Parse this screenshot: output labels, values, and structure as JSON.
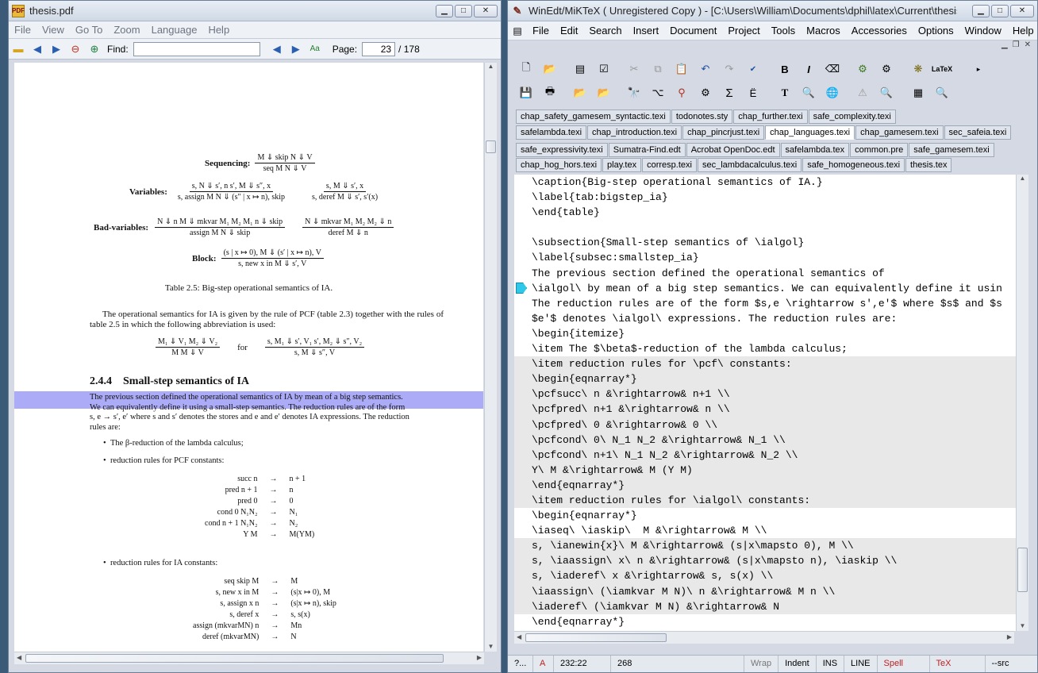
{
  "pdf": {
    "title": "thesis.pdf",
    "menu": [
      "File",
      "View",
      "Go To",
      "Zoom",
      "Language",
      "Help"
    ],
    "find_label": "Find:",
    "find_value": "",
    "page_label": "Page:",
    "page_value": "23",
    "page_total": "/ 178",
    "doc": {
      "seq_label": "Sequencing:",
      "seq_num": "M ⇓ skip   N ⇓ V",
      "seq_den": "seq  M  N ⇓ V",
      "var_label": "Variables:",
      "var1_num": "s, N ⇓ s′, n    s′, M ⇓ s″, x",
      "var1_den": "s, assign M N ⇓ (s″ | x ↦ n), skip",
      "var2_num": "s, M ⇓ s′, x",
      "var2_den": "s, deref M ⇓ s′, s′(x)",
      "bad_label": "Bad-variables:",
      "bad1_num": "N ⇓ n    M ⇓ mkvar M₁ M₂    M₁ n ⇓ skip",
      "bad1_den": "assign M N ⇓ skip",
      "bad2_num": "N ⇓ mkvar M₁ M₂    M₂ ⇓ n",
      "bad2_den": "deref M ⇓ n",
      "block_label": "Block:",
      "block_num": "(s | x ↦ 0), M ⇓ (s′ | x ↦ n), V",
      "block_den": "s, new x in M ⇓ s′, V",
      "caption": "Table 2.5: Big-step operational semantics of IA.",
      "para1": "The operational semantics for IA is given by the rule of PCF (table 2.3) together with the rules of table 2.5 in which the following abbreviation is used:",
      "abbr_l_num": "M₁ ⇓ V₁    M₂ ⇓ V₂",
      "abbr_l_den": "M M ⇓ V",
      "abbr_for": "for",
      "abbr_r_num": "s, M₁ ⇓ s′, V₁    s′, M₂ ⇓ s″, V₂",
      "abbr_r_den": "s, M ⇓ s″, V",
      "section": "2.4.4    Small-step semantics of IA",
      "para2_l1": "The previous section defined the operational semantics of IA by mean of a big step semantics.",
      "para2_l2": "We can equivalently define it using a small-step semantics.  The reduction rules are of the form",
      "para2_l3": "s, e → s′, e′ where s and s′ denotes the stores and e and e′ denotes IA expressions.  The reduction",
      "para2_l4": "rules are:",
      "bullet1": "The β-reduction of the lambda calculus;",
      "bullet2": "reduction rules for PCF constants:",
      "pcf_rules": [
        [
          "succ n",
          "→",
          "n + 1"
        ],
        [
          "pred n + 1",
          "→",
          "n"
        ],
        [
          "pred 0",
          "→",
          "0"
        ],
        [
          "cond 0 N₁N₂",
          "→",
          "N₁"
        ],
        [
          "cond n + 1 N₁N₂",
          "→",
          "N₂"
        ],
        [
          "Y M",
          "→",
          "M(YM)"
        ]
      ],
      "bullet3": "reduction rules for IA constants:",
      "ia_rules": [
        [
          "seq skip M",
          "→",
          "M"
        ],
        [
          "s, new x in M",
          "→",
          "(s|x ↦ 0), M"
        ],
        [
          "s, assign x n",
          "→",
          "(s|x ↦ n), skip"
        ],
        [
          "s, deref x",
          "→",
          "s, s(x)"
        ],
        [
          "assign (mkvarMN) n",
          "→",
          "Mn"
        ],
        [
          "deref (mkvarMN)",
          "→",
          "N"
        ]
      ]
    }
  },
  "winedt": {
    "title": "WinEdt/MiKTeX  ( Unregistered  Copy )  - [C:\\Users\\William\\Documents\\dphil\\latex\\Current\\thesis...",
    "menu": [
      "File",
      "Edit",
      "Search",
      "Insert",
      "Document",
      "Project",
      "Tools",
      "Macros",
      "Accessories",
      "Options",
      "Window",
      "Help"
    ],
    "tabs_row1": [
      "chap_safety_gamesem_syntactic.texi",
      "todonotes.sty",
      "chap_further.texi",
      "safe_complexity.texi"
    ],
    "tabs_row2": [
      "safelambda.texi",
      "chap_introduction.texi",
      "chap_pincrjust.texi",
      "chap_languages.texi",
      "chap_gamesem.texi",
      "sec_safeia.texi"
    ],
    "tabs_row3": [
      "safe_expressivity.texi",
      "Sumatra-Find.edt",
      "Acrobat OpenDoc.edt",
      "safelambda.tex",
      "common.pre",
      "safe_gamesem.texi"
    ],
    "tabs_row4": [
      "chap_hog_hors.texi",
      "play.tex",
      "corresp.texi",
      "sec_lambdacalculus.texi",
      "safe_homogeneous.texi",
      "thesis.tex"
    ],
    "code": [
      "\\caption{Big-step operational semantics of IA.}",
      "\\label{tab:bigstep_ia}",
      "\\end{table}",
      "",
      "\\subsection{Small-step semantics of \\ialgol}",
      "\\label{subsec:smallstep_ia}",
      "The previous section defined the operational semantics of",
      "\\ialgol\\ by mean of a big step semantics. We can equivalently define it usin",
      "The reduction rules are of the form $s,e \\rightarrow s',e'$ where $s$ and $s",
      "$e'$ denotes \\ialgol\\ expressions. The reduction rules are:",
      "\\begin{itemize}",
      "\\item The $\\beta$-reduction of the lambda calculus;",
      "\\item reduction rules for \\pcf\\ constants:",
      "\\begin{eqnarray*}",
      "\\pcfsucc\\ n &\\rightarrow& n+1 \\\\",
      "\\pcfpred\\ n+1 &\\rightarrow& n \\\\",
      "\\pcfpred\\ 0 &\\rightarrow& 0 \\\\",
      "\\pcfcond\\ 0\\ N_1 N_2 &\\rightarrow& N_1 \\\\",
      "\\pcfcond\\ n+1\\ N_1 N_2 &\\rightarrow& N_2 \\\\",
      "Y\\ M &\\rightarrow& M (Y M)",
      "\\end{eqnarray*}",
      "\\item reduction rules for \\ialgol\\ constants:",
      "\\begin{eqnarray*}",
      "\\iaseq\\ \\iaskip\\  M &\\rightarrow& M \\\\",
      "s, \\ianewin{x}\\ M &\\rightarrow& (s|x\\mapsto 0), M \\\\",
      "s, \\iaassign\\ x\\ n &\\rightarrow& (s|x\\mapsto n), \\iaskip \\\\",
      "s, \\iaderef\\ x &\\rightarrow& s, s(x) \\\\",
      "\\iaassign\\ (\\iamkvar M N)\\ n &\\rightarrow& M n \\\\",
      "\\iaderef\\ (\\iamkvar M N) &\\rightarrow& N",
      "\\end{eqnarray*}"
    ],
    "status": [
      "?...",
      "A",
      "232:22",
      "268",
      "Wrap",
      "Indent",
      "INS",
      "LINE",
      "Spell",
      "TeX",
      "--src"
    ]
  }
}
